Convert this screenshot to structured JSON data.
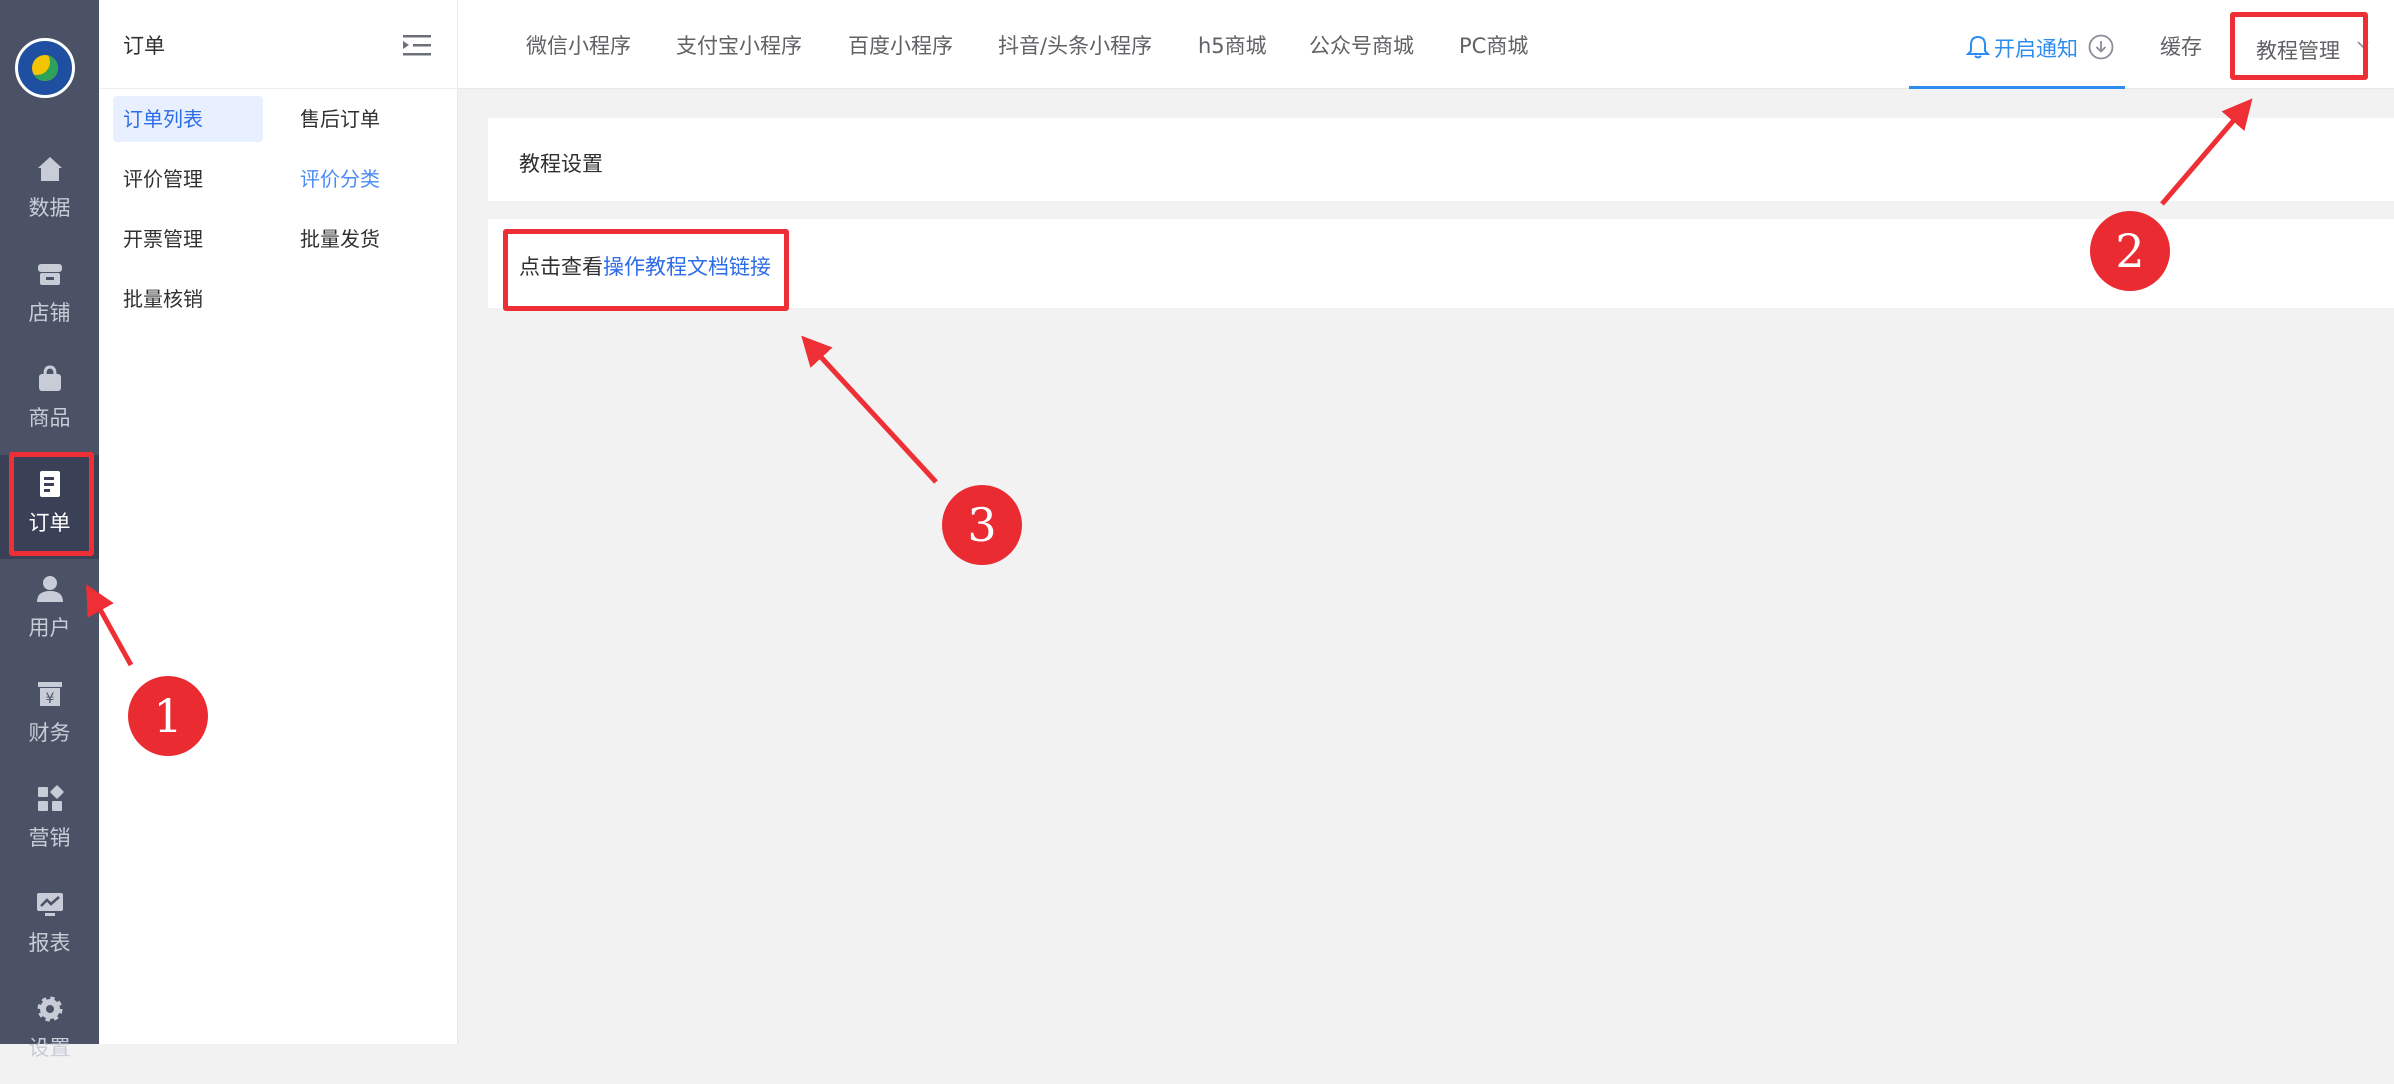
{
  "rail": {
    "items": [
      {
        "label": "数据",
        "icon": "home-icon"
      },
      {
        "label": "店铺",
        "icon": "shop-icon"
      },
      {
        "label": "商品",
        "icon": "bag-icon"
      },
      {
        "label": "订单",
        "icon": "order-icon"
      },
      {
        "label": "用户",
        "icon": "user-icon"
      },
      {
        "label": "财务",
        "icon": "finance-icon"
      },
      {
        "label": "营销",
        "icon": "marketing-icon"
      },
      {
        "label": "报表",
        "icon": "report-icon"
      },
      {
        "label": "设置",
        "icon": "gear-icon"
      }
    ],
    "active": "订单"
  },
  "submenu": {
    "title": "订单",
    "items": [
      "订单列表",
      "售后订单",
      "评价管理",
      "评价分类",
      "开票管理",
      "批量发货",
      "批量核销"
    ],
    "active": "订单列表"
  },
  "topbar": {
    "tabs": [
      "微信小程序",
      "支付宝小程序",
      "百度小程序",
      "抖音/头条小程序",
      "h5商城",
      "公众号商城",
      "PC商城"
    ],
    "notify": "开启通知",
    "cache": "缓存",
    "tutorial_menu": "教程管理"
  },
  "content": {
    "section_title": "教程设置",
    "prompt_text": "点击查看",
    "link_text": "操作教程文档链接"
  },
  "annotations": {
    "badges": [
      "1",
      "2",
      "3"
    ],
    "color": "#ee2f36"
  }
}
